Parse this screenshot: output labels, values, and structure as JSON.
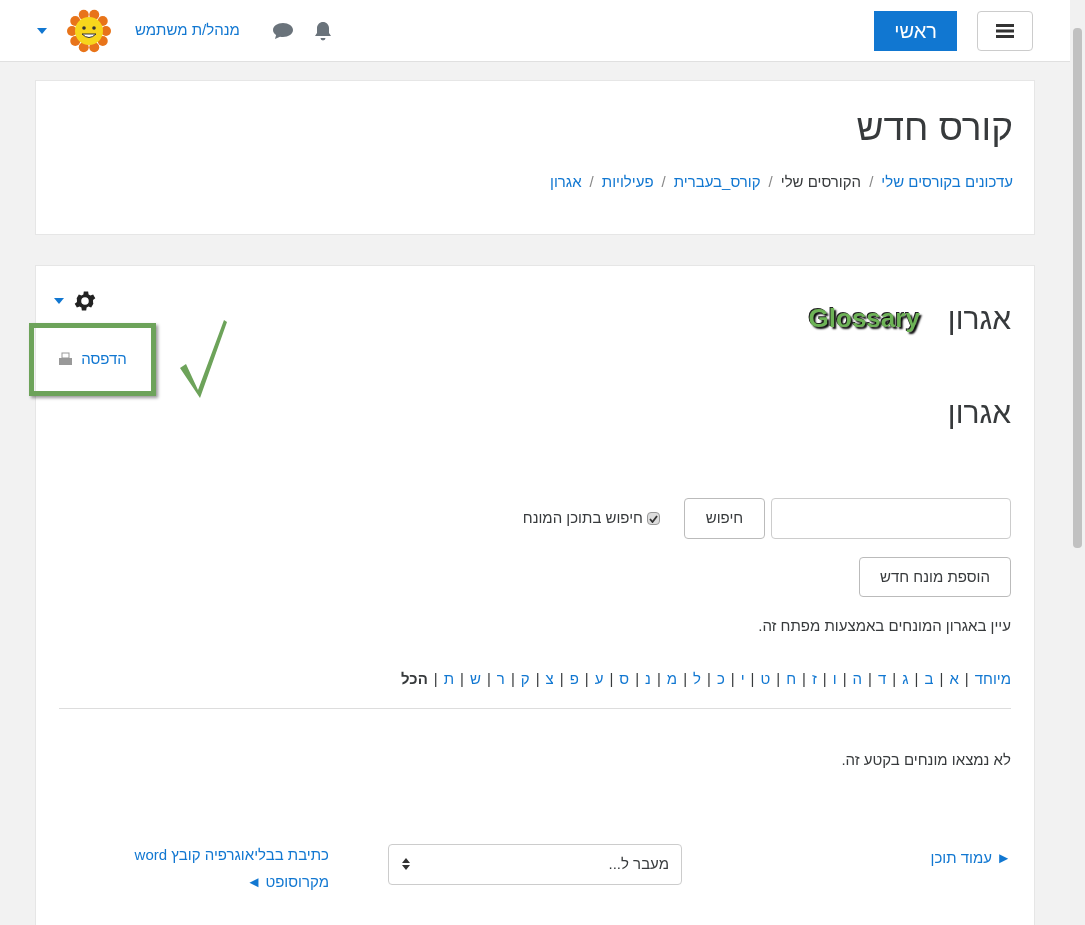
{
  "navbar": {
    "home_button": "ראשי",
    "user_name": "מנהל/ת משתמש"
  },
  "page_header": {
    "title": "קורס חדש",
    "breadcrumbs": [
      {
        "label": "עדכונים בקורסים שלי",
        "link": true
      },
      {
        "separator": "/",
        "label": "הקורסים שלי",
        "link": false
      },
      {
        "separator": "/",
        "label": "קורס_בעברית",
        "link": true
      },
      {
        "separator": "/",
        "label": "פעילויות",
        "link": true
      },
      {
        "separator": "/",
        "label": "אגרון",
        "link": true
      }
    ]
  },
  "activity": {
    "title": "אגרון",
    "annotation_label": "Glossary",
    "print_link": "הדפסה",
    "heading": "אגרון",
    "search": {
      "button": "חיפוש",
      "checkbox_label": "חיפוש בתוכן המונח",
      "checked": true
    },
    "add_button": "הוספת מונח חדש",
    "browse_hint": "עיין באגרון המונחים באמצעות מפתח זה.",
    "letters": [
      {
        "label": "מיוחד",
        "selected": false
      },
      {
        "separator": "|",
        "label": "א",
        "selected": false
      },
      {
        "separator": "|",
        "label": "ב",
        "selected": false
      },
      {
        "separator": "|",
        "label": "ג",
        "selected": false
      },
      {
        "separator": "|",
        "label": "ד",
        "selected": false
      },
      {
        "separator": "|",
        "label": "ה",
        "selected": false
      },
      {
        "separator": "|",
        "label": "ו",
        "selected": false
      },
      {
        "separator": "|",
        "label": "ז",
        "selected": false
      },
      {
        "separator": "|",
        "label": "ח",
        "selected": false
      },
      {
        "separator": "|",
        "label": "ט",
        "selected": false
      },
      {
        "separator": "|",
        "label": "י",
        "selected": false
      },
      {
        "separator": "|",
        "label": "כ",
        "selected": false
      },
      {
        "separator": "|",
        "label": "ל",
        "selected": false
      },
      {
        "separator": "|",
        "label": "מ",
        "selected": false
      },
      {
        "separator": "|",
        "label": "נ",
        "selected": false
      },
      {
        "separator": "|",
        "label": "ס",
        "selected": false
      },
      {
        "separator": "|",
        "label": "ע",
        "selected": false
      },
      {
        "separator": "|",
        "label": "פ",
        "selected": false
      },
      {
        "separator": "|",
        "label": "צ",
        "selected": false
      },
      {
        "separator": "|",
        "label": "ק",
        "selected": false
      },
      {
        "separator": "|",
        "label": "ר",
        "selected": false
      },
      {
        "separator": "|",
        "label": "ש",
        "selected": false
      },
      {
        "separator": "|",
        "label": "ת",
        "selected": false
      },
      {
        "separator": "|",
        "label": "הכל",
        "selected": true
      }
    ],
    "empty_message": "לא נמצאו מונחים בקטע זה.",
    "footer": {
      "prev_link": "► עמוד תוכן",
      "jump_select": "מעבר ל...",
      "next_link": "כתיבת בבליאוגרפיה קובץ word מקרוסופט ◄"
    }
  }
}
